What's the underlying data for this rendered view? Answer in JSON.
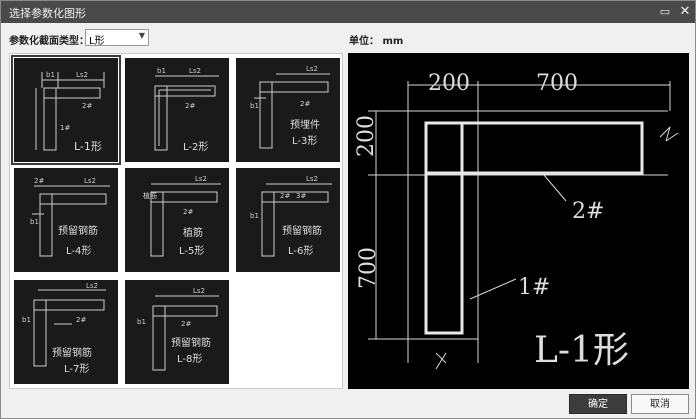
{
  "window": {
    "title": "选择参数化图形"
  },
  "toolbar": {
    "section_type_label": "参数化截面类型：",
    "section_type_value": "L形",
    "unit_label": "单位： mm"
  },
  "shapes": [
    {
      "name": "L-1形",
      "line1": "L-1形",
      "line2": ""
    },
    {
      "name": "L-2形",
      "line1": "L-2形",
      "line2": ""
    },
    {
      "name": "L-3形",
      "line1": "预埋件",
      "line2": "L-3形"
    },
    {
      "name": "L-4形",
      "line1": "预留钢筋",
      "line2": "L-4形"
    },
    {
      "name": "L-5形",
      "line1": "植筋",
      "line2": "L-5形"
    },
    {
      "name": "L-6形",
      "line1": "预留钢筋",
      "line2": "L-6形"
    },
    {
      "name": "L-7形",
      "line1": "预留钢筋",
      "line2": "L-7形"
    },
    {
      "name": "L-8形",
      "line1": "预留钢筋",
      "line2": "L-8形"
    }
  ],
  "thumb_labels": {
    "b1": "b1",
    "ls2": "Ls2",
    "bar1": "1#",
    "bar2": "2#",
    "bar3": "3#",
    "anchor": "植筋"
  },
  "preview": {
    "dim_top_left": "200",
    "dim_top_right": "700",
    "dim_side_top": "200",
    "dim_side_bottom": "700",
    "bar_1": "1#",
    "bar_2": "2#",
    "shape_label": "L-1形"
  },
  "buttons": {
    "ok": "确定",
    "cancel": "取消"
  }
}
